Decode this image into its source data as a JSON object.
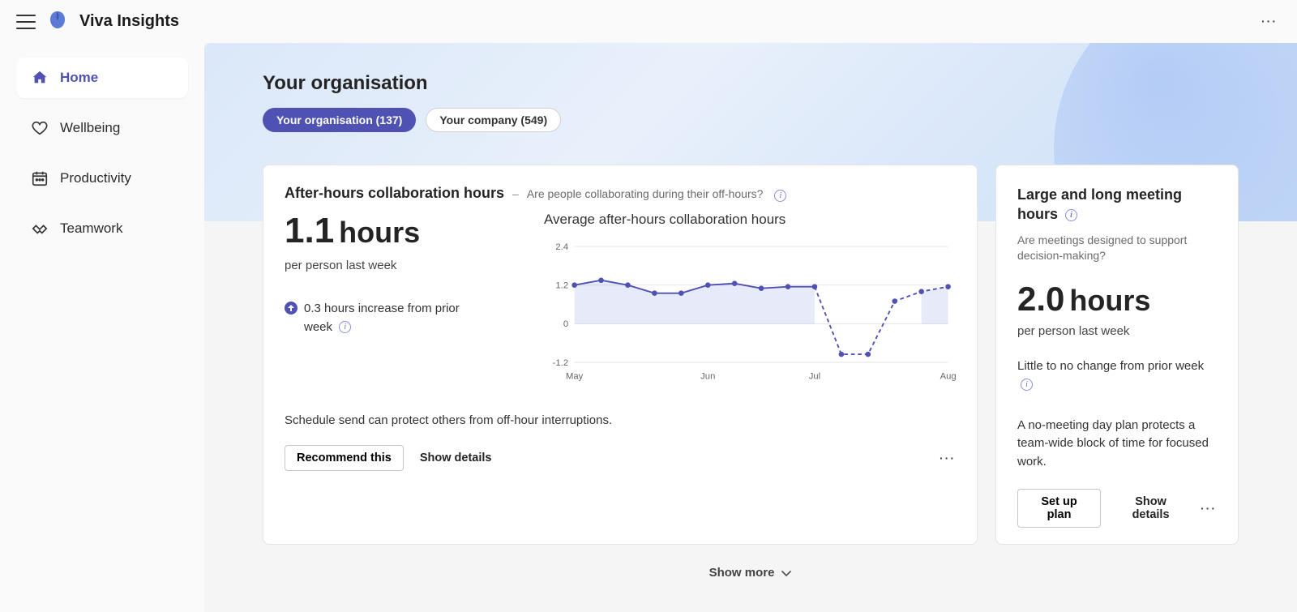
{
  "app": {
    "title": "Viva Insights"
  },
  "sidebar": {
    "items": [
      {
        "label": "Home"
      },
      {
        "label": "Wellbeing"
      },
      {
        "label": "Productivity"
      },
      {
        "label": "Teamwork"
      }
    ]
  },
  "hero": {
    "title": "Your organisation",
    "pills": [
      {
        "label": "Your organisation (137)"
      },
      {
        "label": "Your company (549)"
      }
    ]
  },
  "card_after_hours": {
    "title": "After-hours collaboration hours",
    "question": "Are people collaborating during their off-hours?",
    "value": "1.1",
    "unit": "hours",
    "per_person": "per person last week",
    "delta": "0.3 hours increase from prior week",
    "chart_title": "Average after-hours collaboration hours",
    "tip": "Schedule send can protect others from off-hour interruptions.",
    "recommend_label": "Recommend this",
    "details_label": "Show details"
  },
  "card_meetings": {
    "title": "Large and long meeting hours",
    "question": "Are meetings designed to support decision-making?",
    "value": "2.0",
    "unit": "hours",
    "per_person": "per person last week",
    "change": "Little to no change from prior week",
    "tip": "A no-meeting day plan protects a team-wide block of time for focused work.",
    "setup_label": "Set up plan",
    "details_label": "Show details"
  },
  "footer": {
    "show_more": "Show more"
  },
  "chart_data": {
    "type": "line",
    "title": "Average after-hours collaboration hours",
    "xlabel": "",
    "ylabel": "",
    "ylim": [
      -1.2,
      2.4
    ],
    "y_ticks": [
      -1.2,
      0,
      1.2,
      2.4
    ],
    "categories": [
      "May",
      "Jun",
      "Jul",
      "Aug"
    ],
    "x": [
      0,
      1,
      2,
      3,
      4,
      5,
      6,
      7,
      8,
      9,
      10,
      11,
      12,
      13,
      14
    ],
    "values": [
      1.2,
      1.35,
      1.2,
      0.95,
      0.95,
      1.2,
      1.25,
      1.1,
      1.15,
      1.15,
      -0.95,
      -0.95,
      0.7,
      1.0,
      1.15
    ],
    "dashed_from_index": 9
  }
}
